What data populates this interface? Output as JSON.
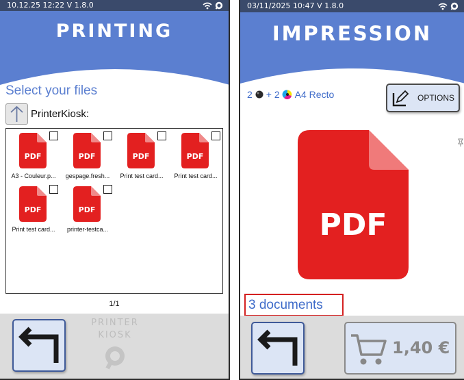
{
  "left": {
    "status_text": "10.12.25 12:22 V 1.8.0",
    "title": "PRINTING",
    "subtitle": "Select your files",
    "folder_name": "PrinterKiosk:",
    "files": [
      {
        "name": "A3 - Couleur.p..."
      },
      {
        "name": "gespage.fresh..."
      },
      {
        "name": "Print test card..."
      },
      {
        "name": "Print test card..."
      },
      {
        "name": "Print test card..."
      },
      {
        "name": "printer-testca..."
      }
    ],
    "pdf_badge": "PDF",
    "pagination": "1/1",
    "brand_line1": "PRINTER",
    "brand_line2": "KIOSK"
  },
  "right": {
    "status_text": "03/11/2025 10:47 V 1.8.0",
    "title": "IMPRESSION",
    "summary_prefix": "2",
    "summary_middle": "+ 2",
    "summary_suffix": "A4 Recto",
    "options_label": "OPTIONS",
    "pdf_label": "PDF",
    "documents_label": "3 documents",
    "price": "1,40 €"
  },
  "colors": {
    "header_blue": "#5b7fd0",
    "accent_blue": "#3e6bc9",
    "pdf_red": "#e32020",
    "status_bar": "#3a4a6b",
    "highlight_red": "#d42020"
  },
  "icons": [
    "wifi-icon",
    "app-logo-icon",
    "upload-arrow-icon",
    "pdf-file-icon",
    "checkbox-icon",
    "back-arrow-icon",
    "edit-icon",
    "cart-icon",
    "toner-black-icon",
    "toner-color-icon"
  ]
}
